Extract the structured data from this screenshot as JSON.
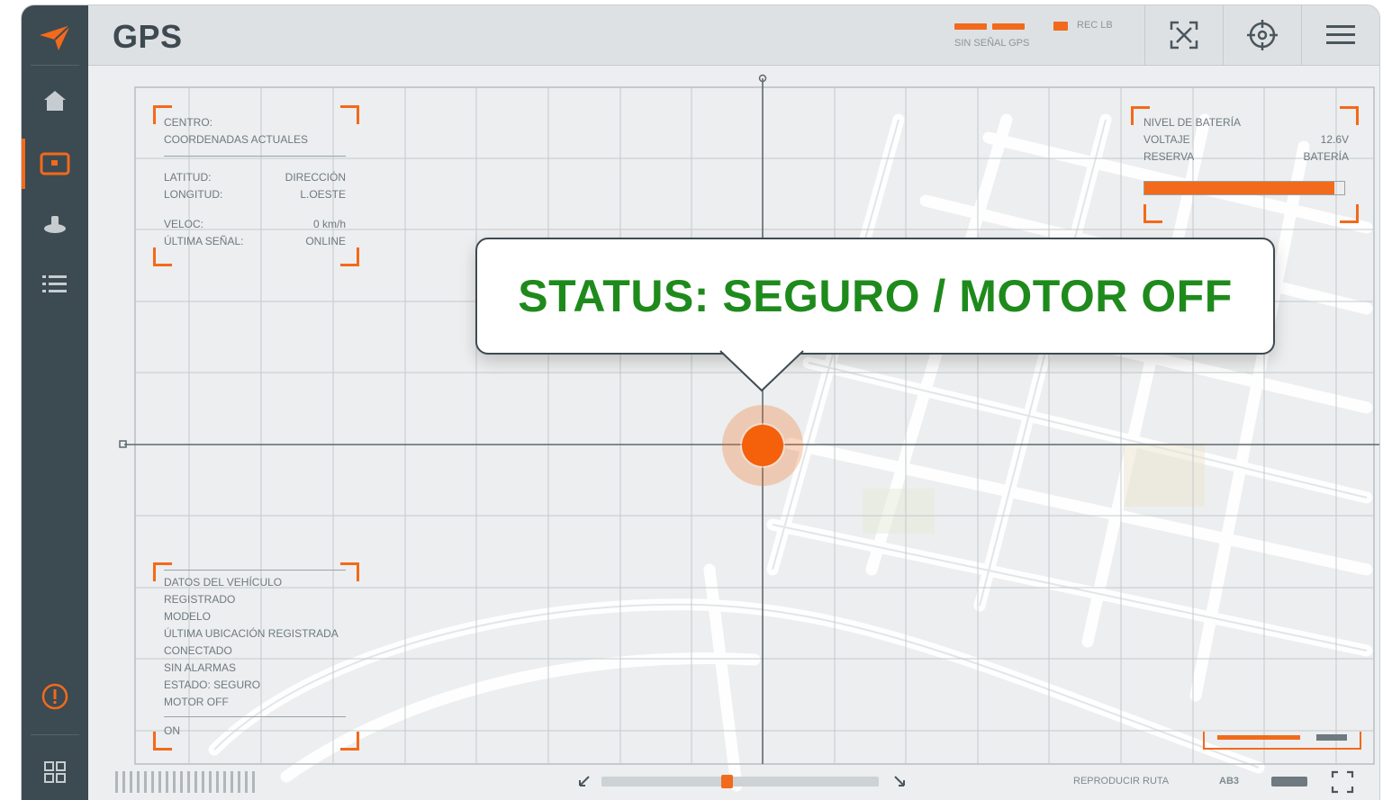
{
  "app": {
    "title": "GPS"
  },
  "header": {
    "status_label": "SIN SEÑAL GPS",
    "status_tag": "REC LB",
    "buttons": [
      {
        "name": "expand-view",
        "icon": "expand-icon"
      },
      {
        "name": "locate",
        "icon": "crosshair-icon"
      },
      {
        "name": "menu",
        "icon": "hamburger-icon"
      }
    ]
  },
  "sidebar": {
    "items": [
      {
        "name": "logo",
        "icon": "paper-plane-logo-icon"
      },
      {
        "name": "home",
        "icon": "home-icon"
      },
      {
        "name": "map",
        "icon": "map-screen-icon",
        "active": true
      },
      {
        "name": "vehicle",
        "icon": "vehicle-icon"
      },
      {
        "name": "list",
        "icon": "list-icon"
      },
      {
        "name": "alert",
        "icon": "alert-icon"
      },
      {
        "name": "grid",
        "icon": "grid-icon"
      }
    ]
  },
  "panel_top_left": {
    "title": "CENTRO:",
    "subtitle": "COORDENADAS ACTUALES",
    "rows": [
      {
        "k": "LATITUD:",
        "v": "DIRECCIÓN"
      },
      {
        "k": "LONGITUD:",
        "v": "L.OESTE"
      },
      {
        "k": "VELOC:",
        "v": "0 km/h"
      },
      {
        "k": "ÚLTIMA SEÑAL:",
        "v": "ONLINE"
      }
    ]
  },
  "panel_top_right": {
    "title": "NIVEL DE BATERÍA",
    "rows": [
      {
        "k": "VOLTAJE",
        "v": "12.6V"
      },
      {
        "k": "RESERVA",
        "v": "BATERÍA"
      }
    ],
    "battery_level": 0.95
  },
  "panel_bottom_left": {
    "lines": [
      "DATOS DEL VEHÍCULO REGISTRADO",
      "MODELO",
      "ÚLTIMA UBICACIÓN REGISTRADA",
      "CONECTADO",
      "SIN ALARMAS",
      "ESTADO: SEGURO",
      "MOTOR OFF"
    ],
    "footer": "ON"
  },
  "status": {
    "text": "STATUS: SEGURO / MOTOR OFF",
    "color": "#1f8a1c"
  },
  "bottom_bar": {
    "timeline_position": 0.45,
    "right_label": "REPRODUCIR RUTA",
    "zoom_label": "AB3"
  },
  "colors": {
    "accent": "#f26a1b",
    "sidebar": "#3c4a52",
    "status_green": "#1f8a1c"
  }
}
